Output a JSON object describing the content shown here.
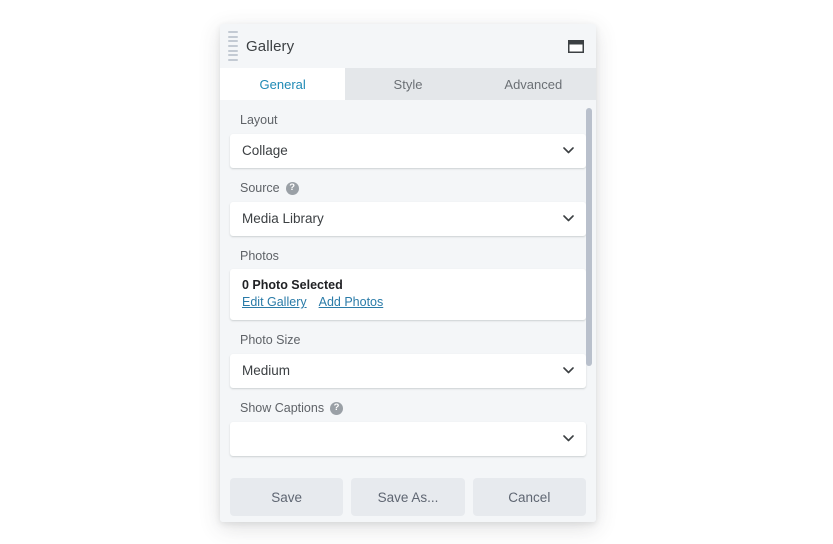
{
  "window": {
    "title": "Gallery",
    "grip_icon": "drag-handle-icon",
    "window_icon": "window-restore-icon"
  },
  "tabs": [
    {
      "label": "General",
      "active": true
    },
    {
      "label": "Style",
      "active": false
    },
    {
      "label": "Advanced",
      "active": false
    }
  ],
  "fields": {
    "layout": {
      "label": "Layout",
      "value": "Collage",
      "chevron_icon": "chevron-down-icon"
    },
    "source": {
      "label": "Source",
      "value": "Media Library",
      "help_icon": "help-circle-icon",
      "help_glyph": "?",
      "chevron_icon": "chevron-down-icon"
    },
    "photos": {
      "label": "Photos",
      "count_text": "0 Photo Selected",
      "edit_link": "Edit Gallery",
      "add_link": "Add Photos"
    },
    "photo_size": {
      "label": "Photo Size",
      "value": "Medium",
      "chevron_icon": "chevron-down-icon"
    },
    "show_captions": {
      "label": "Show Captions",
      "help_icon": "help-circle-icon",
      "help_glyph": "?",
      "value": ""
    }
  },
  "footer": {
    "save_label": "Save",
    "save_as_label": "Save As...",
    "cancel_label": "Cancel"
  },
  "colors": {
    "accent": "#1f8ab5",
    "link": "#2a7ba8",
    "dialog_bg": "#f4f6f8",
    "tabbar_bg": "#e4e7ea",
    "button_bg": "#e7eaee",
    "scroll_thumb": "#b9c0cc"
  }
}
